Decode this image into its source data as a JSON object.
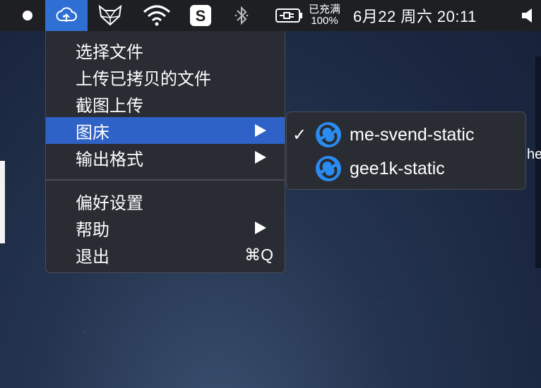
{
  "menubar": {
    "icons": [
      "dot-icon",
      "cloud-upload-icon",
      "fox-icon",
      "wifi-icon",
      "sogou-s-icon",
      "bluetooth-icon",
      "battery-plug-icon",
      "volume-icon"
    ],
    "battery_line1": "已充满",
    "battery_line2": "100%",
    "clock": "6月22 周六 20:11"
  },
  "menu": {
    "items": [
      {
        "label": "选择文件"
      },
      {
        "label": "上传已拷贝的文件"
      },
      {
        "label": "截图上传"
      },
      {
        "label": "图床",
        "submenu": true,
        "highlighted": true
      },
      {
        "label": "输出格式",
        "submenu": true
      },
      {
        "label": "偏好设置"
      },
      {
        "label": "帮助",
        "submenu": true
      },
      {
        "label": "退出",
        "shortcut": "⌘Q"
      }
    ]
  },
  "submenu": {
    "items": [
      {
        "label": "me-svend-static",
        "checked": true,
        "check": "✓"
      },
      {
        "label": "gee1k-static",
        "checked": false
      }
    ],
    "icon_color": "#2a8cf0"
  },
  "background": {
    "edge_text": "he"
  },
  "colors": {
    "highlight": "#2e62c7",
    "menubar": "#1d1f22",
    "menu_bg": "#2a2c33"
  }
}
